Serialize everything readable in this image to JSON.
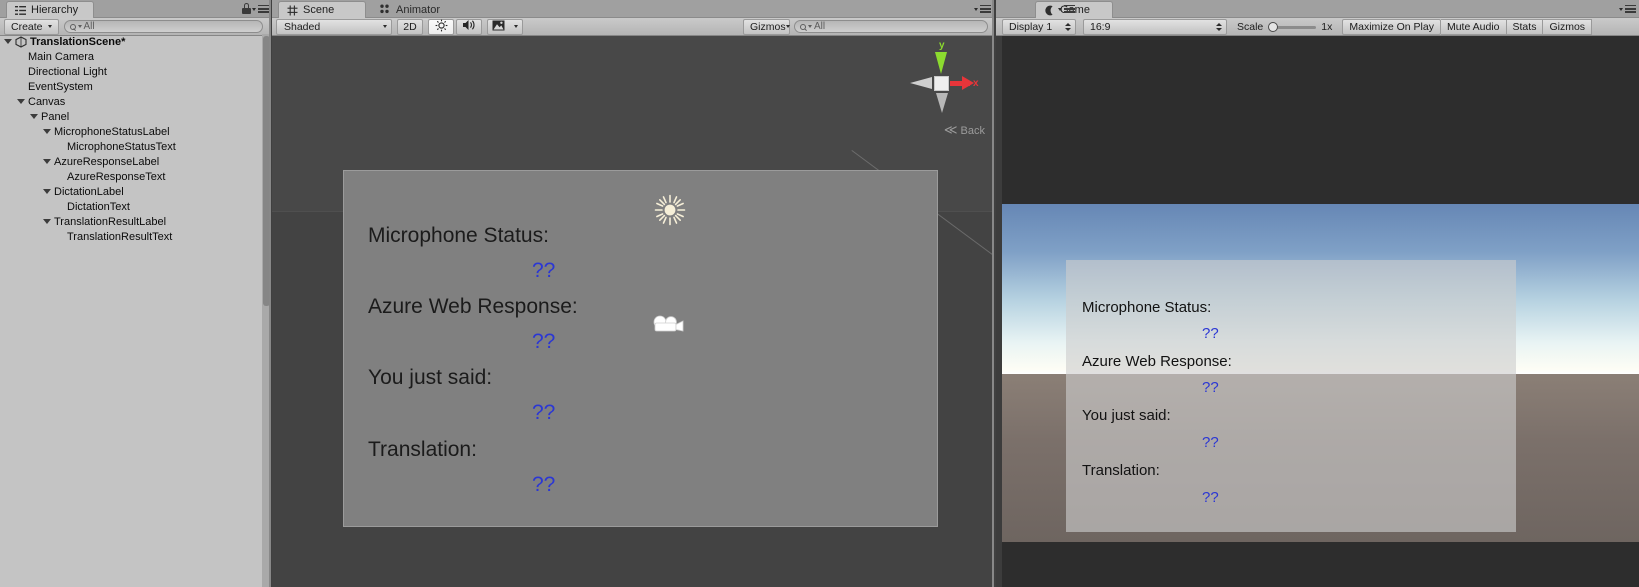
{
  "hierarchy": {
    "tab_label": "Hierarchy",
    "tab_icon": "hierarchy-icon",
    "lock_icon": "lock-icon",
    "menu_icon": "pane-menu-icon",
    "create_label": "Create",
    "search_placeholder": "All",
    "search_value": "",
    "scene_name": "TranslationScene*",
    "items": [
      {
        "label": "Main Camera",
        "depth": 1,
        "expandable": false
      },
      {
        "label": "Directional Light",
        "depth": 1,
        "expandable": false
      },
      {
        "label": "EventSystem",
        "depth": 1,
        "expandable": false
      },
      {
        "label": "Canvas",
        "depth": 1,
        "expandable": true
      },
      {
        "label": "Panel",
        "depth": 2,
        "expandable": true
      },
      {
        "label": "MicrophoneStatusLabel",
        "depth": 3,
        "expandable": true
      },
      {
        "label": "MicrophoneStatusText",
        "depth": 4,
        "expandable": false
      },
      {
        "label": "AzureResponseLabel",
        "depth": 3,
        "expandable": true
      },
      {
        "label": "AzureResponseText",
        "depth": 4,
        "expandable": false
      },
      {
        "label": "DictationLabel",
        "depth": 3,
        "expandable": true
      },
      {
        "label": "DictationText",
        "depth": 4,
        "expandable": false
      },
      {
        "label": "TranslationResultLabel",
        "depth": 3,
        "expandable": true
      },
      {
        "label": "TranslationResultText",
        "depth": 4,
        "expandable": false
      }
    ]
  },
  "scene": {
    "tabs": [
      {
        "label": "Scene",
        "icon": "scene-grid-icon",
        "active": true
      },
      {
        "label": "Animator",
        "icon": "animator-icon",
        "active": false
      }
    ],
    "menu_icon": "pane-menu-icon",
    "toolbar": {
      "draw_mode": "Shaded",
      "view_2d": "2D",
      "lighting_icon": "lighting-sun-icon",
      "audio_icon": "audio-speaker-icon",
      "fx_icon": "effects-image-icon",
      "gizmos_label": "Gizmos",
      "search_placeholder": "All",
      "search_value": ""
    },
    "gizmo": {
      "axis_y_label": "y",
      "axis_x_label": "x",
      "view_label": "Back",
      "y_color": "#8cdb2f",
      "x_color": "#e8353a"
    },
    "icons": {
      "directional_light": "sun-gizmo-icon",
      "camera": "camera-gizmo-icon"
    },
    "panel_rows": [
      {
        "label": "Microphone Status:",
        "value": "??"
      },
      {
        "label": "Azure Web Response:",
        "value": "??"
      },
      {
        "label": "You just said:",
        "value": "??"
      },
      {
        "label": "Translation:",
        "value": "??"
      }
    ]
  },
  "game": {
    "tab_label": "Game",
    "tab_icon": "game-icon",
    "menu_icon": "pane-menu-icon",
    "toolbar": {
      "display": "Display 1",
      "aspect": "16:9",
      "scale_label": "Scale",
      "scale_value": "1x",
      "maximize_label": "Maximize On Play",
      "mute_label": "Mute Audio",
      "stats_label": "Stats",
      "gizmos_label": "Gizmos"
    },
    "panel_rows": [
      {
        "label": "Microphone Status:",
        "value": "??"
      },
      {
        "label": "Azure Web Response:",
        "value": "??"
      },
      {
        "label": "You just said:",
        "value": "??"
      },
      {
        "label": "Translation:",
        "value": "??"
      }
    ]
  },
  "colors": {
    "value_blue": "#2b37d4",
    "panel_gray": "#808080",
    "chrome_gray": "#c4c4c4",
    "scene_bg": "#434343"
  }
}
